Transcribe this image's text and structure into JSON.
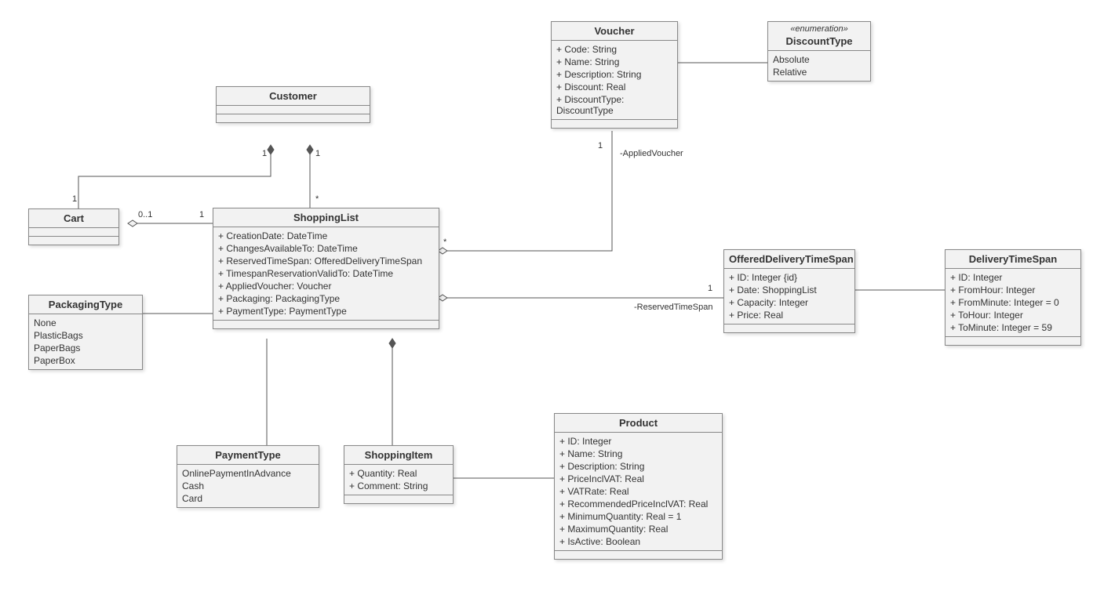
{
  "classes": {
    "customer": {
      "title": "Customer"
    },
    "cart": {
      "title": "Cart"
    },
    "shoppingList": {
      "title": "ShoppingList",
      "attrs": [
        "+ CreationDate: DateTime",
        "+ ChangesAvailableTo: DateTime",
        "+ ReservedTimeSpan: OfferedDeliveryTimeSpan",
        "+ TimespanReservationValidTo: DateTime",
        "+ AppliedVoucher: Voucher",
        "+ Packaging: PackagingType",
        "+ PaymentType: PaymentType"
      ]
    },
    "packagingType": {
      "title": "PackagingType",
      "values": [
        "None",
        "PlasticBags",
        "PaperBags",
        "PaperBox"
      ]
    },
    "paymentType": {
      "title": "PaymentType",
      "values": [
        "OnlinePaymentInAdvance",
        "Cash",
        "Card"
      ]
    },
    "shoppingItem": {
      "title": "ShoppingItem",
      "attrs": [
        "+ Quantity: Real",
        "+ Comment: String"
      ]
    },
    "product": {
      "title": "Product",
      "attrs": [
        "+ ID: Integer",
        "+ Name: String",
        "+ Description: String",
        "+ PriceInclVAT: Real",
        "+ VATRate: Real",
        "+ RecommendedPriceInclVAT: Real",
        "+ MinimumQuantity: Real = 1",
        "+ MaximumQuantity: Real",
        "+ IsActive: Boolean"
      ]
    },
    "voucher": {
      "title": "Voucher",
      "attrs": [
        "+ Code: String",
        "+ Name: String",
        "+ Description: String",
        "+ Discount: Real",
        "+ DiscountType: DiscountType"
      ]
    },
    "discountType": {
      "stereotype": "«enumeration»",
      "title": "DiscountType",
      "values": [
        "Absolute",
        "Relative"
      ]
    },
    "offered": {
      "title": "OfferedDeliveryTimeSpan",
      "attrs": [
        "+ ID: Integer {id}",
        "+ Date: ShoppingList",
        "+ Capacity: Integer",
        "+ Price: Real"
      ]
    },
    "deliveryTS": {
      "title": "DeliveryTimeSpan",
      "attrs": [
        "+ ID: Integer",
        "+ FromHour: Integer",
        "+ FromMinute: Integer = 0",
        "+ ToHour: Integer",
        "+ ToMinute: Integer = 59"
      ]
    }
  },
  "labels": {
    "cust_cart_1a": "1",
    "cust_cart_1b": "1",
    "cart_sl_01": "0..1",
    "cart_sl_1": "1",
    "cust_sl_1": "1",
    "cust_sl_star": "*",
    "sl_voucher_star": "*",
    "sl_voucher_1": "1",
    "sl_voucher_role": "-AppliedVoucher",
    "sl_offered_1": "1",
    "sl_offered_role": "-ReservedTimeSpan"
  }
}
